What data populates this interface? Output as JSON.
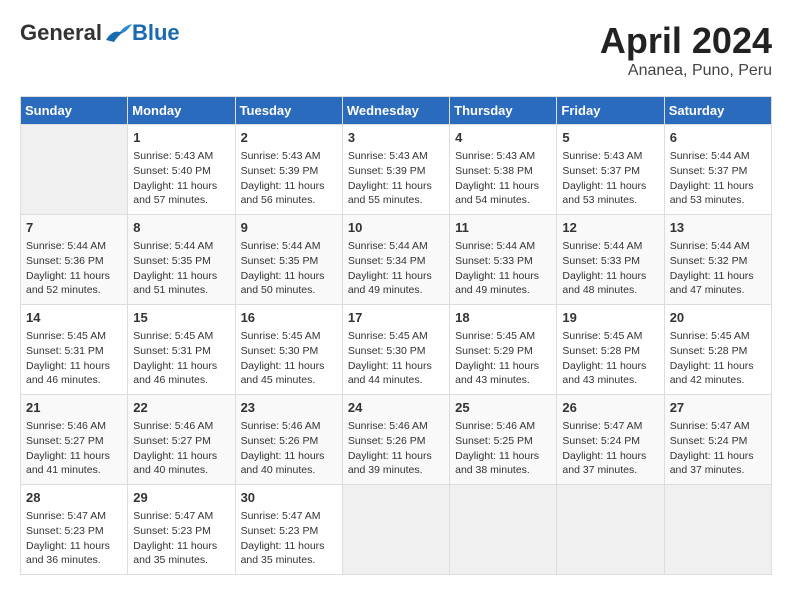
{
  "header": {
    "logo_general": "General",
    "logo_blue": "Blue",
    "month_title": "April 2024",
    "subtitle": "Ananea, Puno, Peru"
  },
  "weekdays": [
    "Sunday",
    "Monday",
    "Tuesday",
    "Wednesday",
    "Thursday",
    "Friday",
    "Saturday"
  ],
  "weeks": [
    [
      {
        "day": "",
        "info": ""
      },
      {
        "day": "1",
        "info": "Sunrise: 5:43 AM\nSunset: 5:40 PM\nDaylight: 11 hours\nand 57 minutes."
      },
      {
        "day": "2",
        "info": "Sunrise: 5:43 AM\nSunset: 5:39 PM\nDaylight: 11 hours\nand 56 minutes."
      },
      {
        "day": "3",
        "info": "Sunrise: 5:43 AM\nSunset: 5:39 PM\nDaylight: 11 hours\nand 55 minutes."
      },
      {
        "day": "4",
        "info": "Sunrise: 5:43 AM\nSunset: 5:38 PM\nDaylight: 11 hours\nand 54 minutes."
      },
      {
        "day": "5",
        "info": "Sunrise: 5:43 AM\nSunset: 5:37 PM\nDaylight: 11 hours\nand 53 minutes."
      },
      {
        "day": "6",
        "info": "Sunrise: 5:44 AM\nSunset: 5:37 PM\nDaylight: 11 hours\nand 53 minutes."
      }
    ],
    [
      {
        "day": "7",
        "info": "Sunrise: 5:44 AM\nSunset: 5:36 PM\nDaylight: 11 hours\nand 52 minutes."
      },
      {
        "day": "8",
        "info": "Sunrise: 5:44 AM\nSunset: 5:35 PM\nDaylight: 11 hours\nand 51 minutes."
      },
      {
        "day": "9",
        "info": "Sunrise: 5:44 AM\nSunset: 5:35 PM\nDaylight: 11 hours\nand 50 minutes."
      },
      {
        "day": "10",
        "info": "Sunrise: 5:44 AM\nSunset: 5:34 PM\nDaylight: 11 hours\nand 49 minutes."
      },
      {
        "day": "11",
        "info": "Sunrise: 5:44 AM\nSunset: 5:33 PM\nDaylight: 11 hours\nand 49 minutes."
      },
      {
        "day": "12",
        "info": "Sunrise: 5:44 AM\nSunset: 5:33 PM\nDaylight: 11 hours\nand 48 minutes."
      },
      {
        "day": "13",
        "info": "Sunrise: 5:44 AM\nSunset: 5:32 PM\nDaylight: 11 hours\nand 47 minutes."
      }
    ],
    [
      {
        "day": "14",
        "info": "Sunrise: 5:45 AM\nSunset: 5:31 PM\nDaylight: 11 hours\nand 46 minutes."
      },
      {
        "day": "15",
        "info": "Sunrise: 5:45 AM\nSunset: 5:31 PM\nDaylight: 11 hours\nand 46 minutes."
      },
      {
        "day": "16",
        "info": "Sunrise: 5:45 AM\nSunset: 5:30 PM\nDaylight: 11 hours\nand 45 minutes."
      },
      {
        "day": "17",
        "info": "Sunrise: 5:45 AM\nSunset: 5:30 PM\nDaylight: 11 hours\nand 44 minutes."
      },
      {
        "day": "18",
        "info": "Sunrise: 5:45 AM\nSunset: 5:29 PM\nDaylight: 11 hours\nand 43 minutes."
      },
      {
        "day": "19",
        "info": "Sunrise: 5:45 AM\nSunset: 5:28 PM\nDaylight: 11 hours\nand 43 minutes."
      },
      {
        "day": "20",
        "info": "Sunrise: 5:45 AM\nSunset: 5:28 PM\nDaylight: 11 hours\nand 42 minutes."
      }
    ],
    [
      {
        "day": "21",
        "info": "Sunrise: 5:46 AM\nSunset: 5:27 PM\nDaylight: 11 hours\nand 41 minutes."
      },
      {
        "day": "22",
        "info": "Sunrise: 5:46 AM\nSunset: 5:27 PM\nDaylight: 11 hours\nand 40 minutes."
      },
      {
        "day": "23",
        "info": "Sunrise: 5:46 AM\nSunset: 5:26 PM\nDaylight: 11 hours\nand 40 minutes."
      },
      {
        "day": "24",
        "info": "Sunrise: 5:46 AM\nSunset: 5:26 PM\nDaylight: 11 hours\nand 39 minutes."
      },
      {
        "day": "25",
        "info": "Sunrise: 5:46 AM\nSunset: 5:25 PM\nDaylight: 11 hours\nand 38 minutes."
      },
      {
        "day": "26",
        "info": "Sunrise: 5:47 AM\nSunset: 5:24 PM\nDaylight: 11 hours\nand 37 minutes."
      },
      {
        "day": "27",
        "info": "Sunrise: 5:47 AM\nSunset: 5:24 PM\nDaylight: 11 hours\nand 37 minutes."
      }
    ],
    [
      {
        "day": "28",
        "info": "Sunrise: 5:47 AM\nSunset: 5:23 PM\nDaylight: 11 hours\nand 36 minutes."
      },
      {
        "day": "29",
        "info": "Sunrise: 5:47 AM\nSunset: 5:23 PM\nDaylight: 11 hours\nand 35 minutes."
      },
      {
        "day": "30",
        "info": "Sunrise: 5:47 AM\nSunset: 5:23 PM\nDaylight: 11 hours\nand 35 minutes."
      },
      {
        "day": "",
        "info": ""
      },
      {
        "day": "",
        "info": ""
      },
      {
        "day": "",
        "info": ""
      },
      {
        "day": "",
        "info": ""
      }
    ]
  ]
}
